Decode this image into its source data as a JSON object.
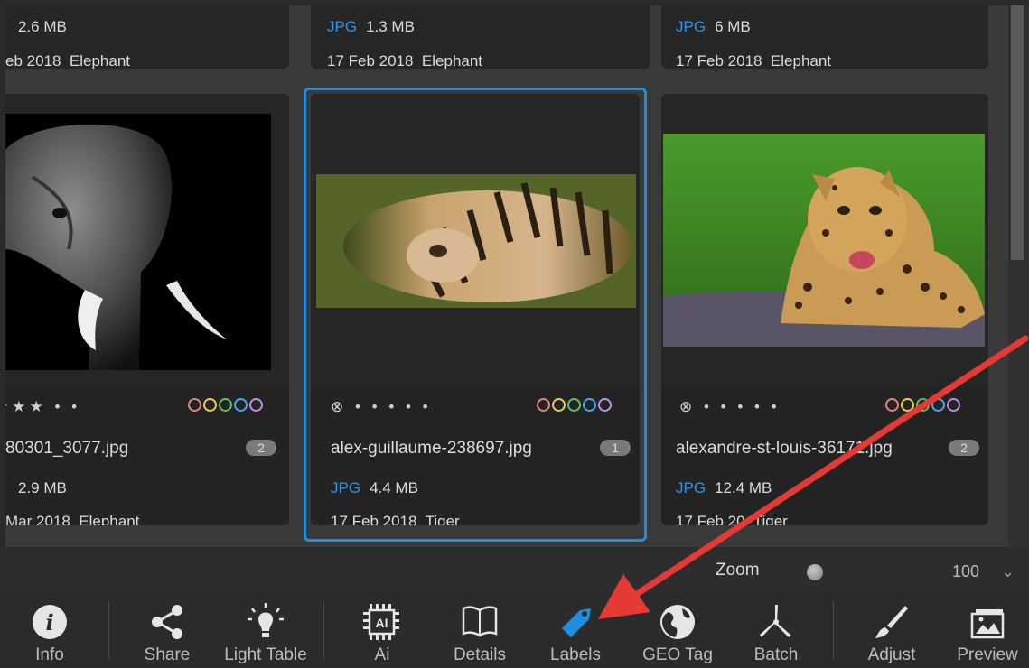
{
  "grid": {
    "top_row": [
      {
        "size": "2.6 MB",
        "date": "eb 2018",
        "tag": "Elephant",
        "format": ""
      },
      {
        "format": "JPG",
        "size": "1.3 MB",
        "date": "17 Feb 2018",
        "tag": "Elephant"
      },
      {
        "format": "JPG",
        "size": "6 MB",
        "date": "17 Feb 2018",
        "tag": "Elephant"
      }
    ],
    "cards": [
      {
        "filename": "80301_3077.jpg",
        "badge": "2",
        "format": "",
        "size": "2.9 MB",
        "date": "Mar 2018",
        "tag": "Elephant",
        "rating": "★★★ • •",
        "photo": "elephant"
      },
      {
        "filename": "alex-guillaume-238697.jpg",
        "badge": "1",
        "format": "JPG",
        "size": "4.4 MB",
        "date": "17 Feb 2018",
        "tag": "Tiger",
        "rating": "⊗ • • • • •",
        "photo": "tiger",
        "selected": true
      },
      {
        "filename": "alexandre-st-louis-36171",
        "filename_tail": ".jpg",
        "badge": "2",
        "format": "JPG",
        "size": "12.4 MB",
        "date": "17 Feb 20",
        "tag": "Tiger",
        "rating": "⊗ • • • • •",
        "photo": "leopard"
      }
    ],
    "color_labels": [
      "red",
      "yellow",
      "green",
      "blue",
      "purple"
    ]
  },
  "zoom": {
    "label": "Zoom",
    "value": "100",
    "chevron": "⌄"
  },
  "toolbar": {
    "items": [
      {
        "label": "Info",
        "icon": "info-icon"
      },
      {
        "label": "Share",
        "icon": "share-icon"
      },
      {
        "label": "Light Table",
        "icon": "light-table-icon"
      },
      {
        "label": "Ai",
        "icon": "ai-chip-icon",
        "icon_text": "AI"
      },
      {
        "label": "Details",
        "icon": "book-icon"
      },
      {
        "label": "Labels",
        "icon": "tag-icon"
      },
      {
        "label": "GEO Tag",
        "icon": "globe-icon"
      },
      {
        "label": "Batch",
        "icon": "pinwheel-icon"
      },
      {
        "label": "Adjust",
        "icon": "brush-icon"
      },
      {
        "label": "Preview",
        "icon": "preview-icon"
      }
    ]
  },
  "colors": {
    "accent": "#1e8fe0",
    "format_blue": "#2f95e8",
    "annotation_arrow": "#e53935"
  }
}
